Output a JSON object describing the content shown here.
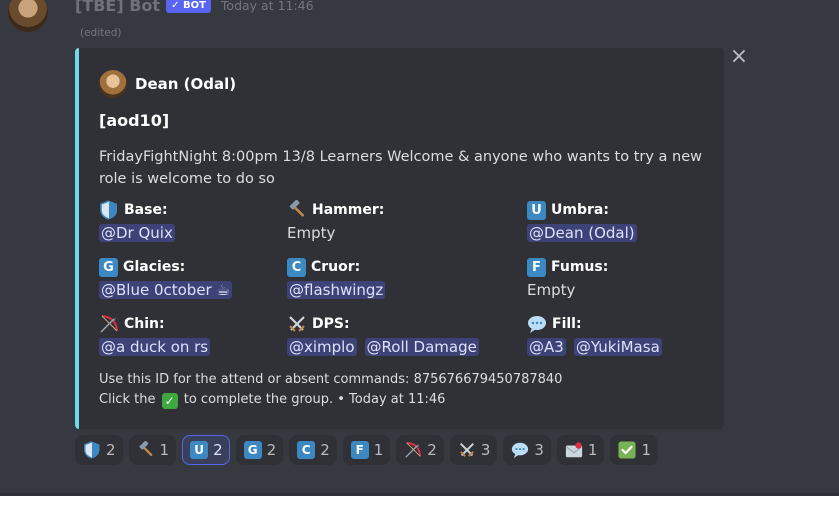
{
  "message": {
    "author": "[TBE] Bot",
    "bot_tag": "BOT",
    "timestamp": "Today at 11:46",
    "edited": "(edited)"
  },
  "close_symbol": "×",
  "embed": {
    "accent_color": "#6fd8e9",
    "author_name": "Dean (Odal)",
    "title": "[aod10]",
    "description": "FridayFightNight 8:00pm 13/8 Learners Welcome & anyone who wants to try a new role is welcome to do so",
    "fields": [
      {
        "icon": "shield-icon",
        "name": "Base:",
        "values": [
          "@Dr Quix"
        ]
      },
      {
        "icon": "hammer-icon",
        "name": "Hammer:",
        "values": [
          "Empty"
        ]
      },
      {
        "icon": "letter-u-icon",
        "letter": "U",
        "name": "Umbra:",
        "values": [
          "@Dean (Odal)"
        ]
      },
      {
        "icon": "letter-g-icon",
        "letter": "G",
        "name": "Glacies:",
        "values": [
          "@Blue 0ctober ☕"
        ]
      },
      {
        "icon": "letter-c-icon",
        "letter": "C",
        "name": "Cruor:",
        "values": [
          "@flashwingz"
        ]
      },
      {
        "icon": "letter-f-icon",
        "letter": "F",
        "name": "Fumus:",
        "values": [
          "Empty"
        ]
      },
      {
        "icon": "bow-and-arrow-icon",
        "name": "Chin:",
        "values": [
          "@a duck on rs"
        ]
      },
      {
        "icon": "crossed-swords-icon",
        "name": "DPS:",
        "values": [
          "@ximplo",
          "@Roll Damage"
        ]
      },
      {
        "icon": "speech-balloon-icon",
        "name": "Fill:",
        "values": [
          "@A3",
          "@YukiMasa"
        ]
      }
    ],
    "footer_line1": "Use this ID for the attend or absent commands: 875676679450787840",
    "footer_line2_pre": "Click the",
    "footer_line2_post": "to complete the group. • Today at 11:46"
  },
  "reactions": [
    {
      "icon": "shield-icon",
      "count": "2"
    },
    {
      "icon": "hammer-icon",
      "count": "1"
    },
    {
      "icon": "letter-u-icon",
      "letter": "U",
      "count": "2",
      "active": true
    },
    {
      "icon": "letter-g-icon",
      "letter": "G",
      "count": "2"
    },
    {
      "icon": "letter-c-icon",
      "letter": "C",
      "count": "2"
    },
    {
      "icon": "letter-f-icon",
      "letter": "F",
      "count": "1"
    },
    {
      "icon": "bow-and-arrow-icon",
      "count": "2"
    },
    {
      "icon": "crossed-swords-icon",
      "count": "3"
    },
    {
      "icon": "speech-balloon-icon",
      "count": "3"
    },
    {
      "icon": "envelope-icon",
      "count": "1"
    },
    {
      "icon": "check-mark-icon",
      "count": "1"
    }
  ]
}
